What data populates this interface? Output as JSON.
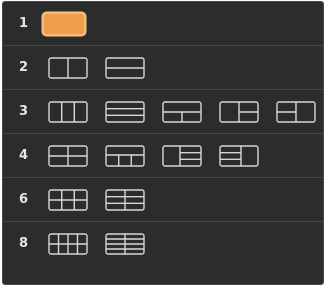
{
  "panel": {
    "name": "screen-layout-picker",
    "colors": {
      "background": "#2c2c2c",
      "icon_stroke": "#d8d8d8",
      "selected_fill": "#f0a04c",
      "label_text": "#e6e6e6"
    },
    "rows": [
      {
        "label": "1",
        "options": [
          {
            "icon": "layout-1-single-icon",
            "selected": true
          }
        ]
      },
      {
        "label": "2",
        "options": [
          {
            "icon": "layout-2-columns-icon"
          },
          {
            "icon": "layout-2-rows-icon"
          }
        ]
      },
      {
        "label": "3",
        "options": [
          {
            "icon": "layout-3-columns-icon"
          },
          {
            "icon": "layout-3-rows-icon"
          },
          {
            "icon": "layout-3-top-bottom-split-icon"
          },
          {
            "icon": "layout-3-left-right-split-icon"
          },
          {
            "icon": "layout-3-right-left-split-icon"
          }
        ]
      },
      {
        "label": "4",
        "options": [
          {
            "icon": "layout-4-grid-icon"
          },
          {
            "icon": "layout-4-top-three-bottom-icon"
          },
          {
            "icon": "layout-4-left-three-right-icon"
          },
          {
            "icon": "layout-4-right-three-left-icon"
          }
        ]
      },
      {
        "label": "6",
        "options": [
          {
            "icon": "layout-6-grid-3x2-icon"
          },
          {
            "icon": "layout-6-grid-2x3-icon"
          }
        ]
      },
      {
        "label": "8",
        "options": [
          {
            "icon": "layout-8-grid-4x2-icon"
          },
          {
            "icon": "layout-8-grid-2x4-icon"
          }
        ]
      }
    ]
  }
}
